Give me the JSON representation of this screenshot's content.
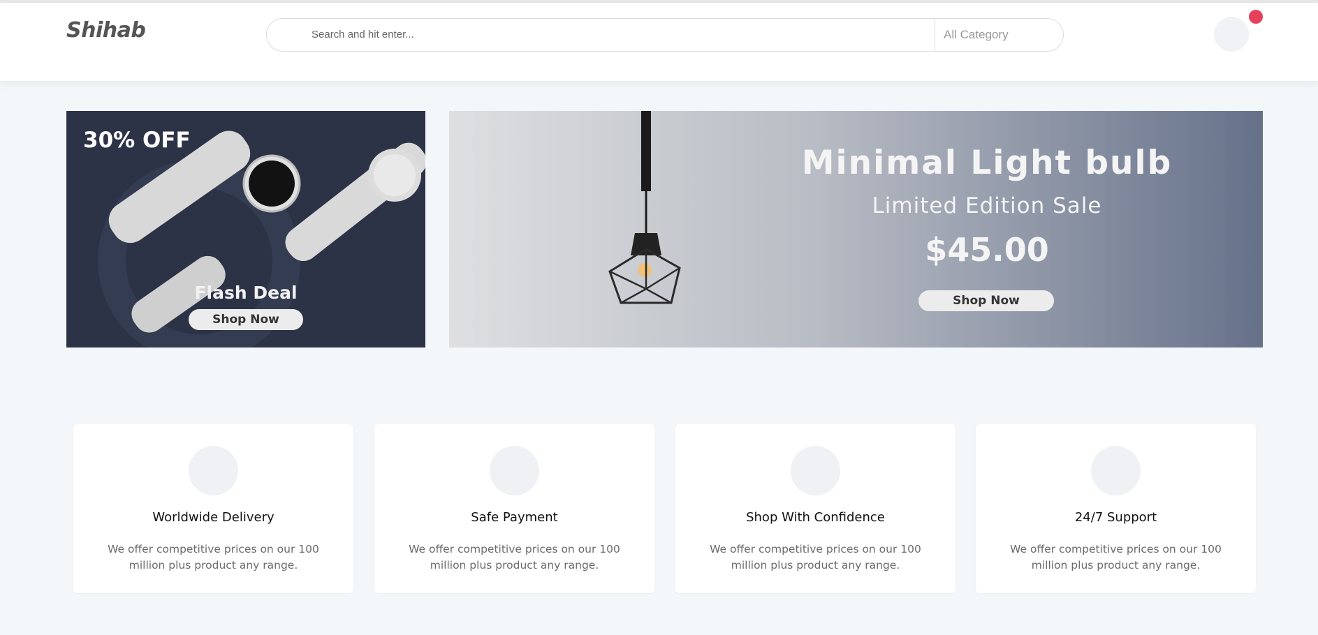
{
  "header": {
    "logo": "Shihab",
    "search": {
      "placeholder": "Search and hit enter...",
      "category": "All Category"
    }
  },
  "banners": {
    "left": {
      "discount": "30% OFF",
      "title": "Flash Deal",
      "button": "Shop Now"
    },
    "right": {
      "title": "Minimal  Light bulb",
      "subtitle": "Limited Edition Sale",
      "price": "$45.00",
      "button": "Shop Now"
    }
  },
  "features": [
    {
      "title": "Worldwide Delivery",
      "desc": "We offer competitive prices on our 100 million plus product any range."
    },
    {
      "title": "Safe Payment",
      "desc": "We offer competitive prices on our 100 million plus product any range."
    },
    {
      "title": "Shop With Confidence",
      "desc": "We offer competitive prices on our 100 million plus product any range."
    },
    {
      "title": "24/7 Support",
      "desc": "We offer competitive prices on our 100 million plus product any range."
    }
  ],
  "colors": {
    "page_bg": "#f4f7fa",
    "flash_banner_bg": "#2c3347",
    "notification": "#e6405a"
  }
}
